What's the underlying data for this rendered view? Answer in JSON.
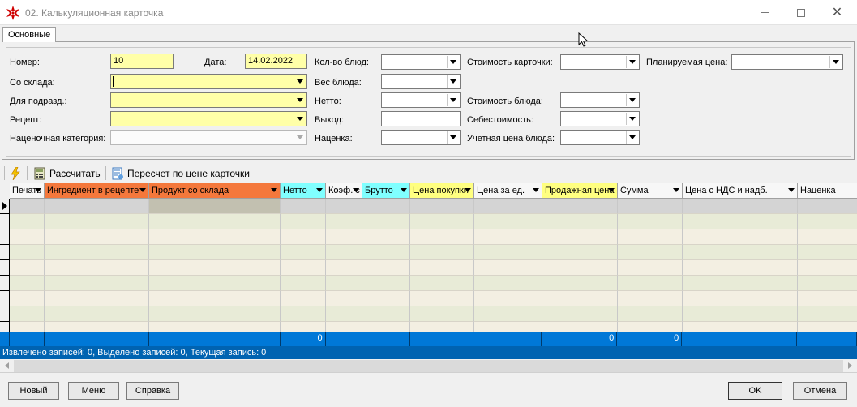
{
  "window": {
    "title": "02. Калькуляционная карточка",
    "minimize": "minimize",
    "maximize": "maximize",
    "close": "close"
  },
  "tabs": [
    {
      "label": "Основные",
      "active": true
    }
  ],
  "form": {
    "number_label": "Номер:",
    "number_value": "10",
    "date_label": "Дата:",
    "date_value": "14.02.2022",
    "from_store_label": "Со склада:",
    "from_store_value": "",
    "for_division_label": "Для подразд.:",
    "for_division_value": "",
    "recipe_label": "Рецепт:",
    "recipe_value": "",
    "markup_category_label": "Наценочная категория:",
    "markup_category_value": "",
    "dish_count_label": "Кол-во блюд:",
    "dish_count_value": "",
    "dish_weight_label": "Вес блюда:",
    "dish_weight_value": "",
    "net_label": "Нетто:",
    "net_value": "",
    "yield_label": "Выход:",
    "yield_value": "",
    "markup_label": "Наценка:",
    "markup_value": "",
    "card_cost_label": "Стоимость карточки:",
    "card_cost_value": "",
    "dish_cost_label": "Стоимость блюда:",
    "dish_cost_value": "",
    "prime_cost_label": "Себестоимость:",
    "prime_cost_value": "",
    "accounting_price_label": "Учетная цена блюда:",
    "accounting_price_value": "",
    "planned_price_label": "Планируемая цена:",
    "planned_price_value": ""
  },
  "toolbar": {
    "calculate_label": "Рассчитать",
    "recalc_label": "Пересчет по цене карточки"
  },
  "grid": {
    "columns": [
      {
        "label": "Печать",
        "color": "#f7f7f7"
      },
      {
        "label": "Ингредиент в рецепте",
        "color": "#f4783c"
      },
      {
        "label": "Продукт со склада",
        "color": "#f4783c"
      },
      {
        "label": "Нетто",
        "color": "#80ffff"
      },
      {
        "label": "Коэф. с",
        "color": "#f7f7f7"
      },
      {
        "label": "Брутто",
        "color": "#80ffff"
      },
      {
        "label": "Цена покупки",
        "color": "#ffff80"
      },
      {
        "label": "Цена за ед.",
        "color": "#f7f7f7"
      },
      {
        "label": "Продажная цена",
        "color": "#ffff80"
      },
      {
        "label": "Сумма",
        "color": "#f7f7f7"
      },
      {
        "label": "Цена с НДС и надб.",
        "color": "#f7f7f7"
      },
      {
        "label": "Наценка",
        "color": "#f7f7f7"
      }
    ],
    "totals": [
      "",
      "",
      "",
      "0",
      "",
      "",
      "",
      "",
      "0",
      "0",
      "",
      ""
    ]
  },
  "status": {
    "text": "Извлечено записей: 0, Выделено записей: 0, Текущая запись: 0"
  },
  "buttons": {
    "new_label": "Новый",
    "menu_label": "Меню",
    "help_label": "Справка",
    "ok_label": "OK",
    "cancel_label": "Отмена"
  },
  "colors": {
    "required_field": "#ffffa8",
    "footer": "#0078d7",
    "status": "#0063b1",
    "grid_odd": "#f3efe2",
    "grid_even": "#e8ebd7",
    "grid_current": "#d4d4d4"
  },
  "icons": [
    "app-icon",
    "lightning-icon",
    "calculator-icon",
    "document-recalc-icon",
    "mouse-cursor-icon"
  ]
}
